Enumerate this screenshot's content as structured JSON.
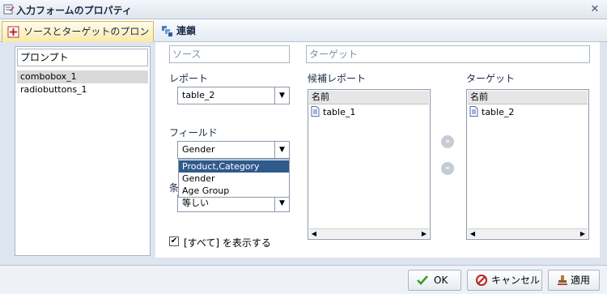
{
  "window": {
    "title": "入力フォームのプロパティ",
    "close_glyph": "✕"
  },
  "tabs": [
    {
      "label": "ソースとターゲットのプロンプト",
      "icon": "prompt-form-icon",
      "selected": true
    },
    {
      "label": "連鎖",
      "icon": "chain-icon",
      "selected": false
    }
  ],
  "prompts": {
    "header": "プロンプト",
    "items": [
      {
        "label": "combobox_1",
        "selected": true
      },
      {
        "label": "radiobuttons_1",
        "selected": false
      }
    ]
  },
  "source": {
    "header": "ソース",
    "report_label": "レポート",
    "report_value": "table_2",
    "field_label": "フィールド",
    "field_value": "Gender",
    "field_options": [
      "Product,Category",
      "Gender",
      "Age Group"
    ],
    "field_highlighted": "Product,Category",
    "condition_label": "条",
    "condition_value": "等しい",
    "show_all_label": "[すべて] を表示する",
    "show_all_checked": true
  },
  "target": {
    "header": "ターゲット",
    "candidate_label": "候補レポート",
    "candidate_column": "名前",
    "candidate_items": [
      "table_1"
    ],
    "target_label": "ターゲット",
    "target_column": "名前",
    "target_items": [
      "table_2"
    ],
    "move_right_glyph": "»",
    "move_left_glyph": "«"
  },
  "footer": {
    "ok_label": "OK",
    "cancel_label": "キャンセル",
    "apply_label": "適用"
  },
  "glyphs": {
    "dropdown_arrow": "▼",
    "check": "✔",
    "scroll_left": "◀",
    "scroll_right": "▶"
  },
  "colors": {
    "accent_selected": "#2f5a8c",
    "tab_active": "#f9e9a8",
    "panel_bg": "#dde5ef"
  }
}
